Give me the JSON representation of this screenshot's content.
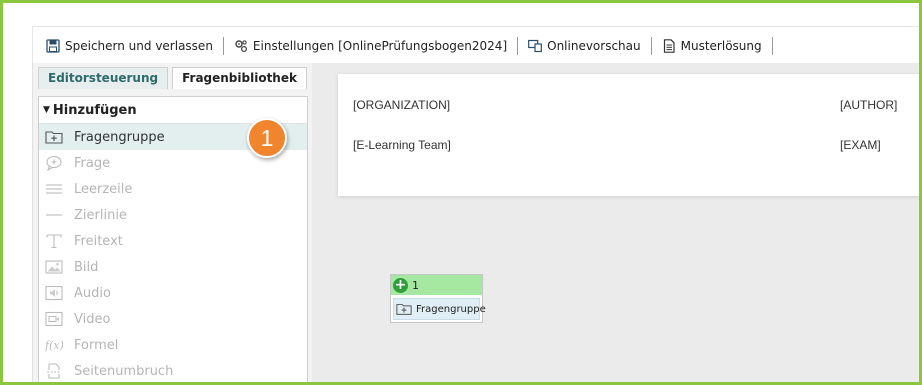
{
  "toolbar": {
    "items": [
      {
        "label": "Speichern und verlassen",
        "icon": "save-icon"
      },
      {
        "label": "Einstellungen [OnlinePrüfungsbogen2024]",
        "icon": "settings-gears-icon"
      },
      {
        "label": "Onlinevorschau",
        "icon": "preview-screens-icon"
      },
      {
        "label": "Musterlösung",
        "icon": "document-icon"
      }
    ]
  },
  "tabs": [
    {
      "label": "Editorsteuerung",
      "state": "inactive"
    },
    {
      "label": "Fragenbibliothek",
      "state": "active"
    }
  ],
  "panel": {
    "section_title": "Hinzufügen",
    "items": [
      {
        "label": "Fragengruppe",
        "icon": "folder-plus-icon",
        "enabled": true
      },
      {
        "label": "Frage",
        "icon": "question-bubble-icon",
        "enabled": false
      },
      {
        "label": "Leerzeile",
        "icon": "blank-lines-icon",
        "enabled": false
      },
      {
        "label": "Zierlinie",
        "icon": "divider-line-icon",
        "enabled": false
      },
      {
        "label": "Freitext",
        "icon": "text-t-icon",
        "enabled": false
      },
      {
        "label": "Bild",
        "icon": "image-icon",
        "enabled": false
      },
      {
        "label": "Audio",
        "icon": "audio-icon",
        "enabled": false
      },
      {
        "label": "Video",
        "icon": "video-icon",
        "enabled": false
      },
      {
        "label": "Formel",
        "icon": "formula-icon",
        "enabled": false
      },
      {
        "label": "Seitenumbruch",
        "icon": "page-break-icon",
        "enabled": false
      }
    ]
  },
  "callout": {
    "number": "1"
  },
  "document_header": {
    "organization": "[ORGANIZATION]",
    "author": "[AUTHOR]",
    "team": "[E-Learning Team]",
    "exam": "[EXAM]"
  },
  "drop_box": {
    "number": "1",
    "item_label": "Fragengruppe"
  },
  "colors": {
    "frame_border": "#8cc63f",
    "callout": "#f0852d",
    "drop_header": "#a6e8a2",
    "add_icon": "#2e9e3a",
    "selected_row": "#e3eeee"
  }
}
